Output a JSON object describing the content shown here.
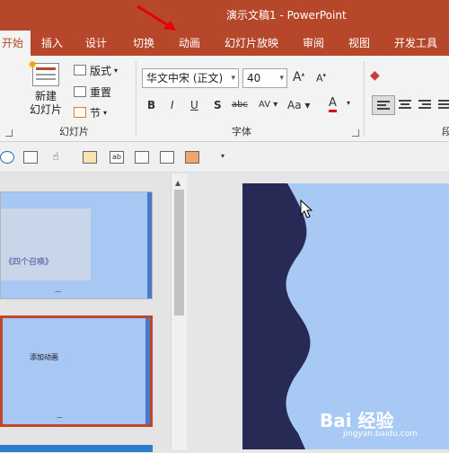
{
  "window": {
    "title": "演示文稿1  -  PowerPoint"
  },
  "tabs": [
    {
      "label": "开始",
      "active": true
    },
    {
      "label": "插入"
    },
    {
      "label": "设计"
    },
    {
      "label": "切换"
    },
    {
      "label": "动画"
    },
    {
      "label": "幻灯片放映"
    },
    {
      "label": "审阅"
    },
    {
      "label": "视图"
    },
    {
      "label": "开发工具"
    }
  ],
  "ribbon": {
    "slides_group": {
      "label": "幻灯片",
      "new_slide_line1": "新建",
      "new_slide_line2": "幻灯片",
      "layout": "版式",
      "reset": "重置",
      "section": "节"
    },
    "font_group": {
      "label": "字体",
      "font_name": "华文中宋 (正文)",
      "font_size": "40",
      "bold": "B",
      "italic": "I",
      "underline": "U",
      "shadow": "S",
      "strikethrough": "abc",
      "char_spacing": "AV",
      "change_case": "Aa",
      "font_color": "A",
      "grow": "A",
      "shrink": "A"
    },
    "paragraph_group": {
      "label": "段"
    }
  },
  "slides": [
    {
      "banner_text": "《四个召唤》"
    },
    {
      "text": "添加动画"
    }
  ],
  "watermark": {
    "brand": "Bai 经验",
    "url": "jingyan.baidu.com"
  },
  "colors": {
    "accent": "#b7472a",
    "slide_bg": "#a9c9f5",
    "wave": "#262a55"
  }
}
